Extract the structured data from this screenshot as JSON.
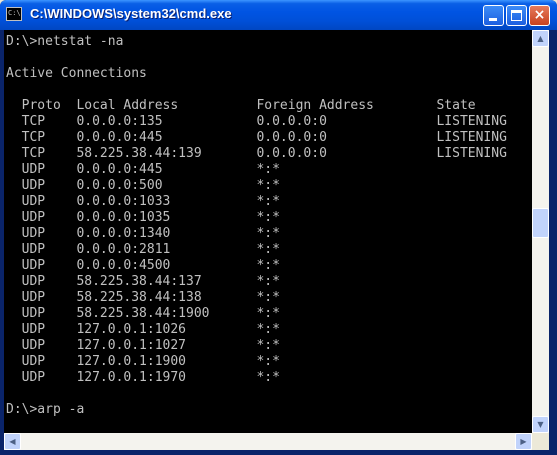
{
  "window": {
    "title": "C:\\WINDOWS\\system32\\cmd.exe",
    "icon_label": "C:\\"
  },
  "titlebar_buttons": {
    "close_glyph": "×"
  },
  "console_text": "D:\\>netstat -na\n\nActive Connections\n\n  Proto  Local Address          Foreign Address        State\n  TCP    0.0.0.0:135            0.0.0.0:0              LISTENING\n  TCP    0.0.0.0:445            0.0.0.0:0              LISTENING\n  TCP    58.225.38.44:139       0.0.0.0:0              LISTENING\n  UDP    0.0.0.0:445            *:*\n  UDP    0.0.0.0:500            *:*\n  UDP    0.0.0.0:1033           *:*\n  UDP    0.0.0.0:1035           *:*\n  UDP    0.0.0.0:1340           *:*\n  UDP    0.0.0.0:2811           *:*\n  UDP    0.0.0.0:4500           *:*\n  UDP    58.225.38.44:137       *:*\n  UDP    58.225.38.44:138       *:*\n  UDP    58.225.38.44:1900      *:*\n  UDP    127.0.0.1:1026         *:*\n  UDP    127.0.0.1:1027         *:*\n  UDP    127.0.0.1:1900         *:*\n  UDP    127.0.0.1:1970         *:*\n\nD:\\>arp -a\n",
  "scrollbar": {
    "up_glyph": "▲",
    "down_glyph": "▼",
    "left_glyph": "◀",
    "right_glyph": "▶"
  },
  "colors": {
    "console_bg": "#000000",
    "console_fg": "#c0c0c0",
    "titlebar": "#0054e3"
  }
}
